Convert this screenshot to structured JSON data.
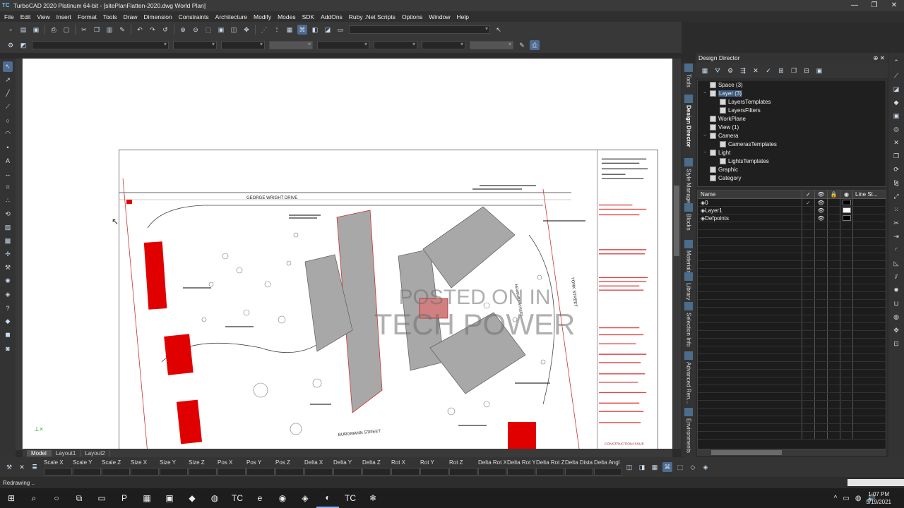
{
  "window": {
    "title": "TurboCAD 2020 Platinum 64-bit - [sitePlanFlatten-2020.dwg World Plan]",
    "app_badge": "TC",
    "controls": [
      "—",
      "❐",
      "✕"
    ]
  },
  "menu": [
    "File",
    "Edit",
    "View",
    "Insert",
    "Format",
    "Tools",
    "Draw",
    "Dimension",
    "Constraints",
    "Architecture",
    "Modify",
    "Modes",
    "SDK",
    "AddOns",
    "Ruby .Net Scripts",
    "Options",
    "Window",
    "Help"
  ],
  "drawing": {
    "street_north": "GEORGE WRIGHT DRIVE",
    "street_south": "BURGMANN STREET",
    "street_east": "YORK STREET",
    "street_center": "NEWBURY STREET",
    "titleblock_note": "CONSTRUCTION ISSUE"
  },
  "watermark": {
    "line1": "POSTED ON IN",
    "line2": "TECH POWER"
  },
  "layout_tabs": [
    "Model",
    "Layout1",
    "Layout2"
  ],
  "design_director": {
    "title": "Design Director",
    "tree": [
      {
        "label": "Space (3)",
        "level": 0,
        "expand": ""
      },
      {
        "label": "Layer (3)",
        "level": 0,
        "expand": "−",
        "selected": true
      },
      {
        "label": "LayersTemplates",
        "level": 1,
        "expand": ""
      },
      {
        "label": "LayersFilters",
        "level": 1,
        "expand": ""
      },
      {
        "label": "WorkPlane",
        "level": 0,
        "expand": ""
      },
      {
        "label": "View (1)",
        "level": 0,
        "expand": ""
      },
      {
        "label": "Camera",
        "level": 0,
        "expand": "−"
      },
      {
        "label": "CamerasTemplates",
        "level": 1,
        "expand": ""
      },
      {
        "label": "Light",
        "level": 0,
        "expand": "−"
      },
      {
        "label": "LightsTemplates",
        "level": 1,
        "expand": ""
      },
      {
        "label": "Graphic",
        "level": 0,
        "expand": ""
      },
      {
        "label": "Category",
        "level": 0,
        "expand": ""
      }
    ],
    "grid_headers": {
      "name": "Name",
      "line_style": "Line St..."
    },
    "layers": [
      {
        "name": "0",
        "current": true,
        "color": "#000000"
      },
      {
        "name": "Layer1",
        "current": false,
        "color": "#ffffff"
      },
      {
        "name": "Defpoints",
        "current": false,
        "color": "#000000"
      }
    ]
  },
  "side_tabs": [
    "Tools",
    "Design Director",
    "Style Manager",
    "Blocks",
    "Materials",
    "Library",
    "Selection Info",
    "Advanced Ren...",
    "Environments"
  ],
  "inspector_fields": [
    "Scale X",
    "Scale Y",
    "Scale Z",
    "Size X",
    "Size Y",
    "Size Z",
    "Pos X",
    "Pos Y",
    "Pos Z",
    "Delta X",
    "Delta Y",
    "Delta Z",
    "Rot X",
    "Rot Y",
    "Rot Z",
    "Delta Rot X",
    "Delta Rot Y",
    "Delta Rot Z",
    "Delta Dista",
    "Delta Angl"
  ],
  "status": {
    "text": "Redrawing .."
  },
  "taskbar": {
    "apps": [
      "⊞",
      "⌕",
      "○",
      "⧉",
      "▭",
      "P",
      "▦",
      "▣",
      "◆",
      "◍",
      "TC",
      "e",
      "◉",
      "◈",
      "◐",
      "TC",
      "❄"
    ],
    "active_index": 14,
    "tray": [
      "^",
      "▭",
      "◍",
      "🔊"
    ],
    "time": "1:07 PM",
    "date": "5/19/2021"
  },
  "colors": {
    "accent": "#4f6b90",
    "building_red": "#e00000",
    "roof_gray": "#a8a8a8"
  }
}
